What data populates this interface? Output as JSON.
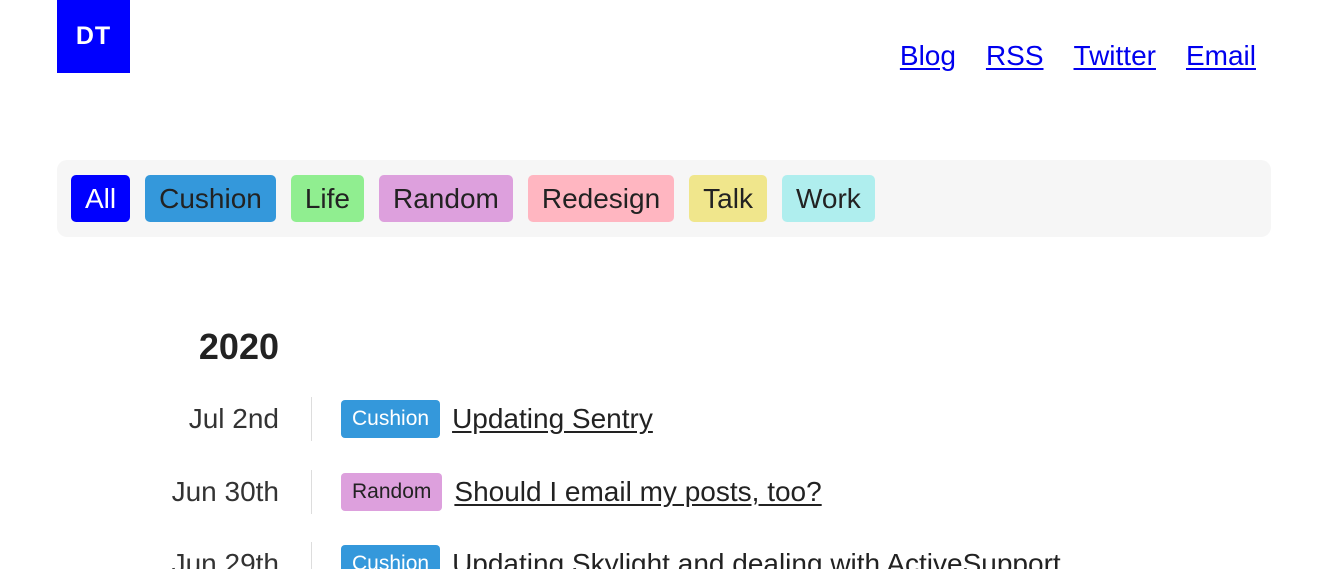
{
  "logo": {
    "text": "DT"
  },
  "nav": {
    "links": [
      "Blog",
      "RSS",
      "Twitter",
      "Email"
    ]
  },
  "filters": [
    {
      "label": "All",
      "color": "#0000ff",
      "active": true
    },
    {
      "label": "Cushion",
      "color": "#3498db",
      "active": false
    },
    {
      "label": "Life",
      "color": "#90ee90",
      "active": false
    },
    {
      "label": "Random",
      "color": "#dda0dd",
      "active": false
    },
    {
      "label": "Redesign",
      "color": "#ffb6c1",
      "active": false
    },
    {
      "label": "Talk",
      "color": "#f0e68c",
      "active": false
    },
    {
      "label": "Work",
      "color": "#afeeee",
      "active": false
    }
  ],
  "timeline": {
    "year": "2020",
    "posts": [
      {
        "date": "Jul 2nd",
        "tag": "Cushion",
        "tag_color": "#3498db",
        "title": "Updating Sentry"
      },
      {
        "date": "Jun 30th",
        "tag": "Random",
        "tag_color": "#dda0dd",
        "title": "Should I email my posts, too?"
      },
      {
        "date": "Jun 29th",
        "tag": "Cushion",
        "tag_color": "#3498db",
        "title": "Updating Skylight and dealing with ActiveSupport"
      }
    ]
  }
}
